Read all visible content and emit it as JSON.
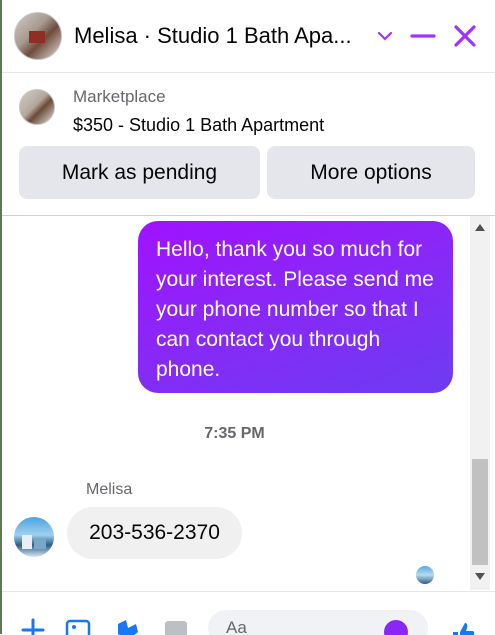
{
  "header": {
    "title": "Melisa · Studio 1 Bath Apa...",
    "accent_color": "#a033ff"
  },
  "marketplace": {
    "label": "Marketplace",
    "item": "$350 - Studio 1 Bath Apartment",
    "buttons": {
      "mark_pending": "Mark as pending",
      "more_options": "More options"
    }
  },
  "conversation": {
    "outgoing_message": "Hello, thank you so much for your interest. Please send me your phone number so that I can contact you through phone.",
    "timestamp": "7:35 PM",
    "sender_name": "Melisa",
    "incoming_message": "203-536-2370"
  },
  "composer": {
    "placeholder": "Aa"
  }
}
